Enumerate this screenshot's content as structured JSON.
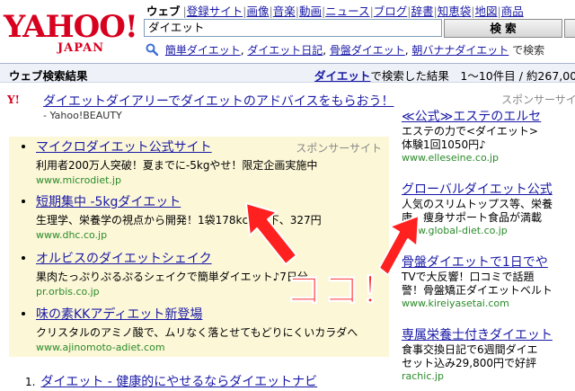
{
  "header": {
    "logo_main": "YAHOO!",
    "logo_sub": "JAPAN",
    "tabs": [
      "ウェブ",
      "登録サイト",
      "画像",
      "音楽",
      "動画",
      "ニュース",
      "ブログ",
      "辞書",
      "知恵袋",
      "地図",
      "商品"
    ],
    "search_value": "ダイエット",
    "search_button": "検 索"
  },
  "related": {
    "items": [
      "簡単ダイエット",
      "ダイエット日記",
      "骨盤ダイエット",
      "朝バナナダイエット"
    ],
    "trail": "で検索"
  },
  "results_bar": {
    "title": "ウェブ検索結果",
    "keyword": "ダイエット",
    "info_text": "で検索した結果　1〜10件目 / 約267,00"
  },
  "promo": {
    "icon": "Y!",
    "link": "ダイエットダイアリーでダイエットのアドバイスをもらおう！",
    "source": "- Yahoo!BEAUTY"
  },
  "sponsor": {
    "label": "スポンサーサイト",
    "ads": [
      {
        "title": "マイクロダイエット公式サイト",
        "desc": "利用者200万人突破！夏までに-5kgやせ！限定企画実施中",
        "url": "www.microdiet.jp"
      },
      {
        "title": "短期集中 -5kgダイエット",
        "desc": "生理学、栄養学の視点から開発！1袋178kcal以下、327円",
        "url": "www.dhc.co.jp"
      },
      {
        "title": "オルビスのダイエットシェイク",
        "desc": "果肉たっぷりぷるぷるシェイクで簡単ダイエット♪7日分",
        "url": "pr.orbis.co.jp"
      },
      {
        "title": "味の素KKアディエット新登場",
        "desc": "クリスタルのアミノ酸で、ムリなく落とせてもどりにくいカラダへ",
        "url": "www.ajinomoto-adiet.com"
      }
    ]
  },
  "right_sponsor": {
    "label": "スポンサーサイト",
    "ads": [
      {
        "title": "≪公式≫エステのエルセ",
        "desc1": "エステの力で<ダイエット>",
        "desc2": "体験1回1050円♪",
        "url": "www.elleseine.co.jp"
      },
      {
        "title": "グローバルダイエット公式",
        "desc1": "人気のスリムトップス等、栄養",
        "desc2": "康・痩身サポート食品が満載",
        "url": "www.global-diet.co.jp"
      },
      {
        "title": "骨盤ダイエットで1日でや",
        "desc1": "TVで大反響！口コミで話題",
        "desc2": "警！骨盤矯正ダイエットベルト",
        "url": "www.kireiyasetai.com"
      },
      {
        "title": "専属栄養士付きダイエット",
        "desc1": "食事交換日記で6週間ダイエ",
        "desc2": "セット込み29,800円で好評",
        "url": "rachic.jp"
      }
    ]
  },
  "organic": {
    "number": "1.",
    "title": "ダイエット - 健康的にやせるならダイエットナビ"
  },
  "annotation": {
    "text": "ココ！",
    "color": "#ff2a2a"
  },
  "colors": {
    "link": "#1a1aa6",
    "url_green": "#2a8a2a",
    "sponsor_bg": "#fcf7d7",
    "logo_red": "#d8001f"
  }
}
